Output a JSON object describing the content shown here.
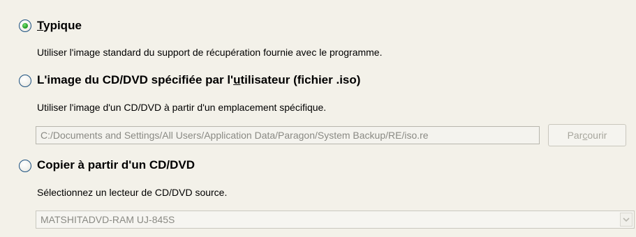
{
  "options": [
    {
      "label_pre": "",
      "label_u": "T",
      "label_post": "ypique",
      "selected": true,
      "description": "Utiliser l'image standard du support de récupération fournie avec le programme."
    },
    {
      "label_pre": "L'image du CD/DVD spécifiée par l'",
      "label_u": "u",
      "label_post": "tilisateur (fichier .iso)",
      "selected": false,
      "description": "Utiliser l'image d'un CD/DVD à partir d'un emplacement spécifique."
    },
    {
      "label_pre": "Copier à partir d'un CD/DVD",
      "label_u": "",
      "label_post": "",
      "selected": false,
      "description": "Sélectionnez un lecteur de CD/DVD source."
    }
  ],
  "iso_path": {
    "value": "C:/Documents and Settings/All Users/Application Data/Paragon/System Backup/RE/iso.re",
    "browse_pre": "Par",
    "browse_u": "c",
    "browse_post": "ourir"
  },
  "drive_select": {
    "selected": "MATSHITADVD-RAM UJ-845S"
  },
  "icons": {
    "dropdown": "chevron-down-icon"
  }
}
